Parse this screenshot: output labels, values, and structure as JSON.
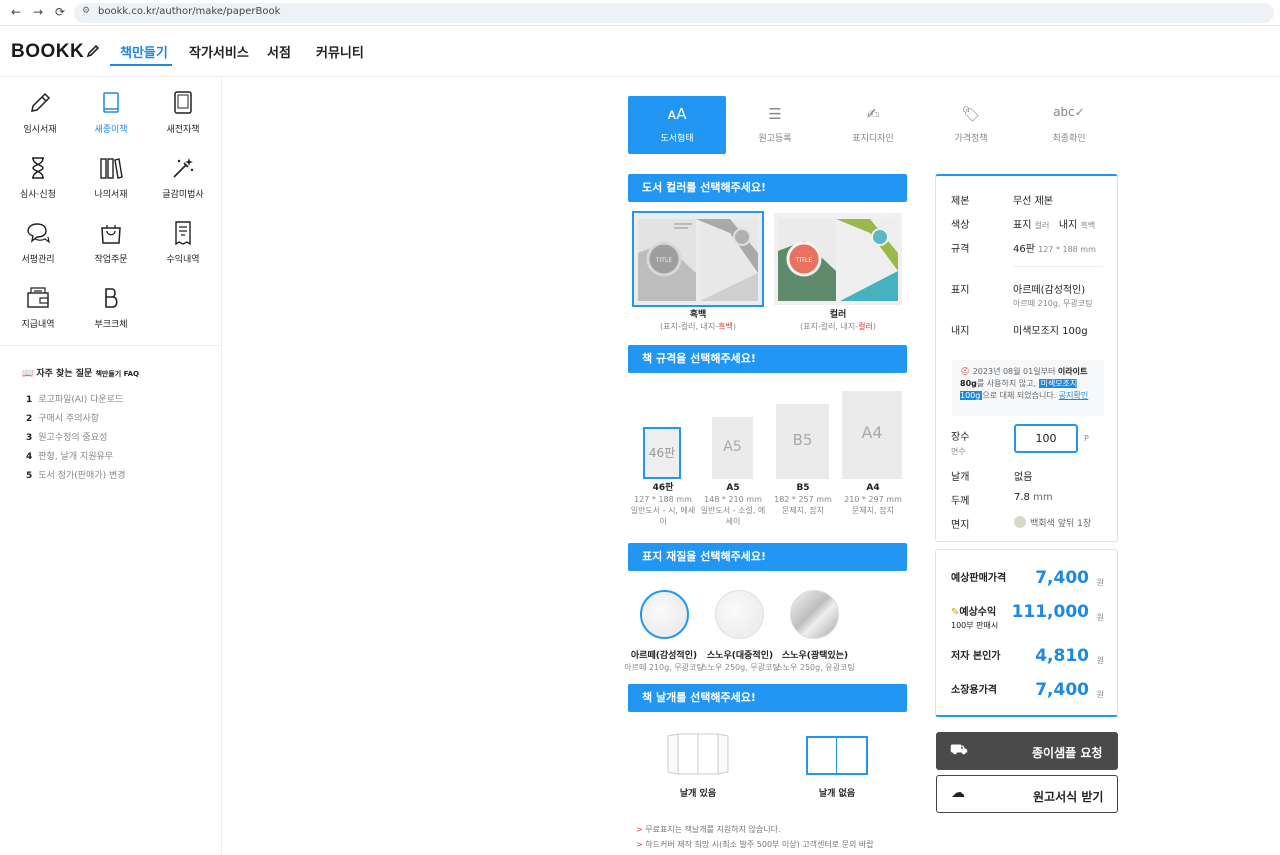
{
  "browser": {
    "url": "bookk.co.kr/author/make/paperBook"
  },
  "header": {
    "logo": "BOOKK",
    "nav": [
      "책만들기",
      "작가서비스",
      "서점",
      "커뮤니티"
    ]
  },
  "sidebar": {
    "items": [
      {
        "label": "임시서재",
        "icon": "pencil-icon"
      },
      {
        "label": "새종이책",
        "icon": "book-icon"
      },
      {
        "label": "새전자책",
        "icon": "tablet-icon"
      },
      {
        "label": "심사·신청",
        "icon": "hourglass-icon"
      },
      {
        "label": "나의서재",
        "icon": "bookshelf-icon"
      },
      {
        "label": "글감미법사",
        "icon": "magic-wand-icon"
      },
      {
        "label": "서평관리",
        "icon": "chat-icon"
      },
      {
        "label": "작업주문",
        "icon": "shopping-bag-icon"
      },
      {
        "label": "수익내역",
        "icon": "receipt-icon"
      },
      {
        "label": "지급내역",
        "icon": "wallet-icon"
      },
      {
        "label": "부크크체",
        "icon": "font-b-icon"
      }
    ],
    "faq": {
      "title": "자주 찾는 질문",
      "subtitle": "책만들기 FAQ",
      "items": [
        {
          "n": "1",
          "t": "로고파일(AI) 다운로드"
        },
        {
          "n": "2",
          "t": "구매시 주의사항"
        },
        {
          "n": "3",
          "t": "원고수정의 중요성"
        },
        {
          "n": "4",
          "t": "판형, 날개 지원유무"
        },
        {
          "n": "5",
          "t": "도서 정가(판매가) 변경"
        }
      ]
    }
  },
  "steps": [
    "도서형태",
    "원고등록",
    "표지디자인",
    "가격정책",
    "최종확인"
  ],
  "sections": {
    "color": "도서 컬러를 선택해주세요!",
    "size": "책 규격을 선택해주세요!",
    "cover": "표지 재질을 선택해주세요!",
    "wing": "책 날개를 선택해주세요!"
  },
  "colorOptions": [
    {
      "name": "흑백",
      "desc_pre": "(표지-컬러, 내지-",
      "desc_hl": "흑백",
      "desc_post": ")",
      "thumb": "TITLE"
    },
    {
      "name": "컬러",
      "desc_pre": "(표지-컬러, 내지-",
      "desc_hl": "컬러",
      "desc_post": ")",
      "thumb": "TITLE"
    }
  ],
  "sizes": [
    {
      "label": "46판",
      "name": "46판",
      "dim": "127 * 188 mm",
      "use": "일반도서 - 시, 에세이"
    },
    {
      "label": "A5",
      "name": "A5",
      "dim": "148 * 210 mm",
      "use": "일반도서 - 소설, 에세이"
    },
    {
      "label": "B5",
      "name": "B5",
      "dim": "182 * 257 mm",
      "use": "문제지, 잡지"
    },
    {
      "label": "A4",
      "name": "A4",
      "dim": "210 * 297 mm",
      "use": "문제지, 잡지"
    }
  ],
  "covers": [
    {
      "name": "아르떼(감성적인)",
      "desc": "아르떼 210g, 무광코팅"
    },
    {
      "name": "스노우(대중적인)",
      "desc": "스노우 250g, 무광코팅"
    },
    {
      "name": "스노우(광택있는)",
      "desc": "스노우 250g, 유광코팅"
    }
  ],
  "wings": [
    {
      "name": "날개 있음"
    },
    {
      "name": "날개 없음"
    }
  ],
  "notes": [
    "무료표지는 책날개를 지원하지 않습니다.",
    "하드커버 제작 희망 시(최소 발주 500부 이상) 고객센터로 문의 바랍"
  ],
  "summary": {
    "binding": {
      "label": "제본",
      "value": "무선 제본"
    },
    "color": {
      "label": "색상",
      "v1": "표지",
      "s1": "컬러",
      "v2": "내지",
      "s2": "흑백"
    },
    "size": {
      "label": "규격",
      "value": "46판",
      "sub": "127 * 188 mm"
    },
    "cover": {
      "label": "표지",
      "value": "아르떼(감성적인)",
      "sub": "아르떼 210g, 무광코팅"
    },
    "inner": {
      "label": "내지",
      "value": "미색모조지 100g"
    },
    "notice": {
      "pre": "2023년 08월 01일부터 ",
      "b1": "이라이트 80g",
      "mid": "를 사용하지 않고, ",
      "hl": "미색모조지 100g",
      "post": "으로 대체 되었습니다. ",
      "link": "공지확인"
    },
    "pages": {
      "label": "장수",
      "sub": "면수",
      "value": "100",
      "unit": "P"
    },
    "wing": {
      "label": "날개",
      "value": "없음"
    },
    "thickness": {
      "label": "두께",
      "value": "7.8",
      "unit": "mm"
    },
    "endpaper": {
      "label": "면지",
      "value": "백회색 앞뒤 1장",
      "swatch": "#d9d9c7"
    }
  },
  "prices": {
    "sale": {
      "label": "예상판매가격",
      "value": "7,400",
      "unit": "원"
    },
    "profit": {
      "label": "예상수익",
      "sub": "100부 판매시",
      "value": "111,000",
      "unit": "원"
    },
    "author": {
      "label": "저자 본인가",
      "value": "4,810",
      "unit": "원"
    },
    "collect": {
      "label": "소장용가격",
      "value": "7,400",
      "unit": "원"
    }
  },
  "buttons": {
    "sample": "종이샘플 요청",
    "template": "원고서식 받기"
  },
  "colors": {
    "accent": "#2196f3",
    "accentText": "#1e88e5",
    "red": "#e53935"
  }
}
